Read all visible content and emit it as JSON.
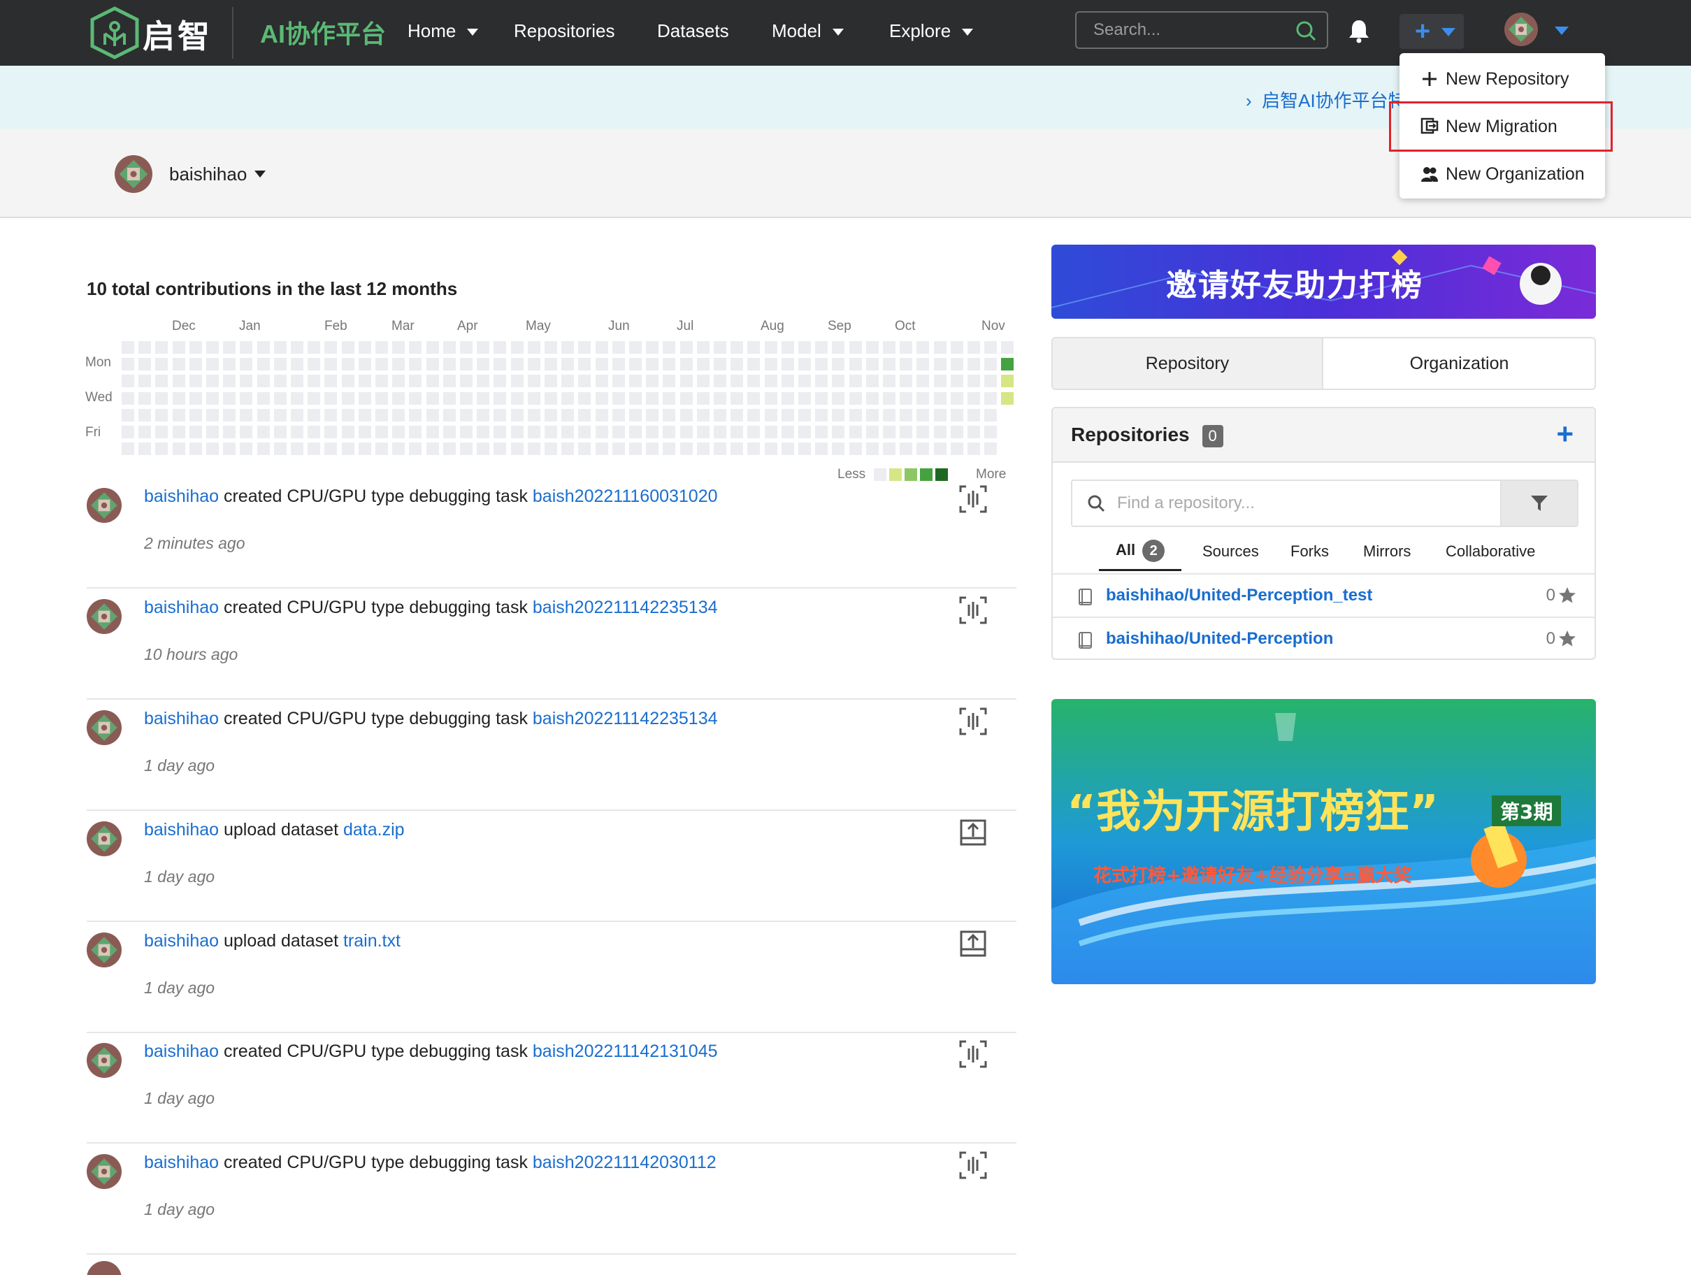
{
  "navbar": {
    "brand": "启智",
    "platform": "AI协作平台",
    "items": [
      {
        "label": "Home",
        "dropdown": true
      },
      {
        "label": "Repositories",
        "dropdown": false
      },
      {
        "label": "Datasets",
        "dropdown": false
      },
      {
        "label": "Model",
        "dropdown": true
      },
      {
        "label": "Explore",
        "dropdown": true
      }
    ],
    "search_placeholder": "Search...",
    "icons": [
      "search-icon",
      "bell-icon",
      "plus-icon",
      "avatar"
    ]
  },
  "notice": {
    "link_text": "启智AI协作平台特"
  },
  "user": {
    "name": "baishihao"
  },
  "create_menu": {
    "items": [
      {
        "label": "New Repository",
        "icon": "plus-icon"
      },
      {
        "label": "New Migration",
        "icon": "migration-icon"
      },
      {
        "label": "New Organization",
        "icon": "organization-icon"
      }
    ],
    "highlighted": "New Migration"
  },
  "contributions": {
    "title": "10 total contributions in the last 12 months",
    "months": [
      "Dec",
      "Jan",
      "Feb",
      "Mar",
      "Apr",
      "May",
      "Jun",
      "Jul",
      "Aug",
      "Sep",
      "Oct",
      "Nov"
    ],
    "days": [
      "Mon",
      "Wed",
      "Fri"
    ],
    "legend_less": "Less",
    "legend_more": "More",
    "levels": [
      "#ebedf0",
      "#d6e685",
      "#8cc665",
      "#44a340",
      "#1e6823"
    ]
  },
  "feed": [
    {
      "user": "baishihao",
      "action": "created CPU/GPU type debugging task",
      "target": "baish202211160031020",
      "time": "2 minutes ago",
      "icon": "debug-task-icon"
    },
    {
      "user": "baishihao",
      "action": "created CPU/GPU type debugging task",
      "target": "baish202211142235134",
      "time": "10 hours ago",
      "icon": "debug-task-icon"
    },
    {
      "user": "baishihao",
      "action": "created CPU/GPU type debugging task",
      "target": "baish202211142235134",
      "time": "1 day ago",
      "icon": "debug-task-icon"
    },
    {
      "user": "baishihao",
      "action": "upload dataset",
      "target": "data.zip",
      "time": "1 day ago",
      "icon": "upload-icon"
    },
    {
      "user": "baishihao",
      "action": "upload dataset",
      "target": "train.txt",
      "time": "1 day ago",
      "icon": "upload-icon"
    },
    {
      "user": "baishihao",
      "action": "created CPU/GPU type debugging task",
      "target": "baish202211142131045",
      "time": "1 day ago",
      "icon": "debug-task-icon"
    },
    {
      "user": "baishihao",
      "action": "created CPU/GPU type debugging task",
      "target": "baish202211142030112",
      "time": "1 day ago",
      "icon": "debug-task-icon"
    }
  ],
  "sidebar": {
    "ad1_text": "邀请好友助力打榜",
    "tabs": [
      "Repository",
      "Organization"
    ],
    "repositories": {
      "title": "Repositories",
      "count": "0",
      "search_placeholder": "Find a repository...",
      "filters": [
        {
          "label": "All",
          "badge": "2"
        },
        {
          "label": "Sources"
        },
        {
          "label": "Forks"
        },
        {
          "label": "Mirrors"
        },
        {
          "label": "Collaborative"
        }
      ],
      "items": [
        {
          "name": "baishihao/United-Perception_test",
          "stars": "0"
        },
        {
          "name": "baishihao/United-Perception",
          "stars": "0"
        }
      ]
    },
    "ad2": {
      "headline": "“我为开源打榜狂”",
      "badge": "第3期",
      "tagline": "花式打榜+邀请好友+经验分享=赢大奖"
    }
  },
  "colors": {
    "navbar_bg": "#2b2d2f",
    "brand_green": "#5bb974",
    "link_blue": "#1a6ecf",
    "accent_blue": "#3b8eea",
    "highlight_red": "#e0222b"
  }
}
